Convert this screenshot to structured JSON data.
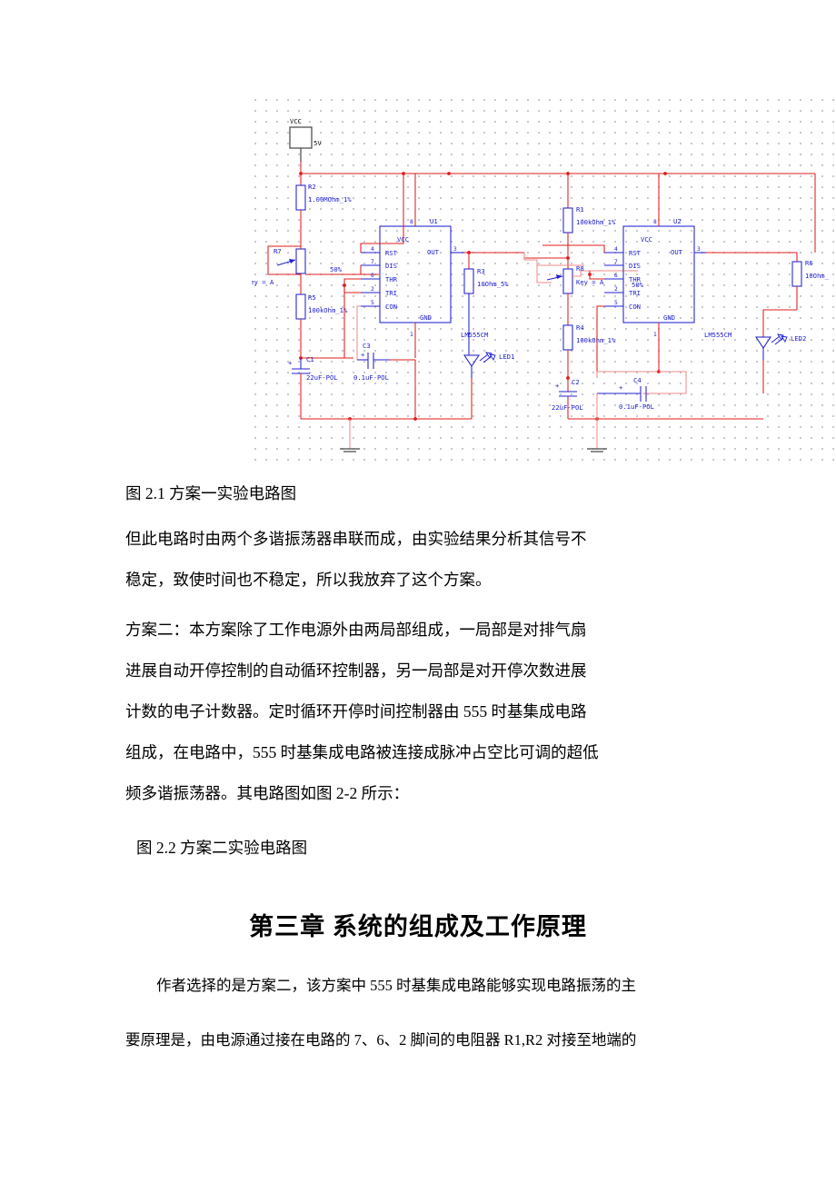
{
  "document": {
    "figure_1": {
      "caption": "图 2.1      方案一实验电路图",
      "schematic": {
        "power": {
          "label": "VCC",
          "value": "5V"
        },
        "ics": [
          {
            "ref": "U1",
            "part": "LM555CM",
            "pins": [
              "VCC",
              "RST",
              "OUT",
              "DIS",
              "THR",
              "TRI",
              "CON",
              "GND"
            ],
            "pin_numbers": {
              "VCC": "8",
              "RST": "4",
              "OUT": "3",
              "DIS": "7",
              "THR": "6",
              "TRI": "2",
              "CON": "5",
              "GND": "1"
            }
          },
          {
            "ref": "U2",
            "part": "LM555CM",
            "pins": [
              "VCC",
              "RST",
              "OUT",
              "DIS",
              "THR",
              "TRI",
              "CON",
              "GND"
            ],
            "pin_numbers": {
              "VCC": "8",
              "RST": "4",
              "OUT": "3",
              "DIS": "7",
              "THR": "6",
              "TRI": "2",
              "CON": "5",
              "GND": "1"
            }
          }
        ],
        "resistors": [
          {
            "ref": "R2",
            "value": "1.00MOhm_1%"
          },
          {
            "ref": "R5",
            "value": "100kOhm_1%"
          },
          {
            "ref": "R3",
            "value": "10Ohm_5%"
          },
          {
            "ref": "R1",
            "value": "100kOhm_1%"
          },
          {
            "ref": "R4",
            "value": "100kOhm_1%"
          },
          {
            "ref": "R6",
            "value": "10Ohm_"
          }
        ],
        "potentiometers": [
          {
            "ref": "R7",
            "key": "Key = A",
            "wiper": "50%"
          },
          {
            "ref": "R8",
            "key": "Key = A",
            "wiper": "50%"
          }
        ],
        "capacitors": [
          {
            "ref": "C1",
            "value": "22uF-POL"
          },
          {
            "ref": "C3",
            "value": "0.1uF-POL"
          },
          {
            "ref": "C2",
            "value": "22uF-POL"
          },
          {
            "ref": "C4",
            "value": "0.1uF-POL"
          }
        ],
        "leds": [
          {
            "ref": "LED1"
          },
          {
            "ref": "LED2"
          }
        ],
        "colors": {
          "wire": "#e01b1b",
          "component": "#2020d0",
          "grid_dot": "#b9b9c6",
          "ground": "#444444"
        }
      }
    },
    "paragraphs": [
      "但此电路时由两个多谐振荡器串联而成，由实验结果分析其信号不",
      "稳定，致使时间也不稳定，所以我放弃了这个方案。",
      "方案二：本方案除了工作电源外由两局部组成，一局部是对排气扇",
      "进展自动开停控制的自动循环控制器，另一局部是对开停次数进展",
      "计数的电子计数器。定时循环开停时间控制器由 555 时基集成电路",
      "组成，在电路中，555 时基集成电路被连接成脉冲占空比可调的超低",
      "频多谐振荡器。其电路图如图 2-2 所示："
    ],
    "figure_2": {
      "caption": "图 2.2      方案二实验电路图"
    },
    "chapter_heading": "第三章   系统的组成及工作原理",
    "closing_paragraphs": [
      "作者选择的是方案二，该方案中 555 时基集成电路能够实现电路振荡的主",
      "要原理是，由电源通过接在电路的 7、6、2 脚间的电阻器 R1,R2 对接至地端的"
    ]
  }
}
